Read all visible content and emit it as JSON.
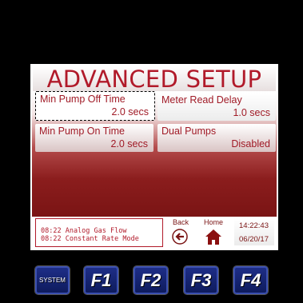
{
  "title": "ADVANCED SETUP",
  "fields": [
    {
      "label": "Min Pump Off Time",
      "value": "2.0 secs"
    },
    {
      "label": "Meter Read Delay",
      "value": "1.0 secs"
    },
    {
      "label": "Min Pump On Time",
      "value": "2.0 secs"
    },
    {
      "label": "Dual Pumps",
      "value": "Disabled"
    }
  ],
  "log": [
    "08:22 Analog Gas Flow",
    "08:22 Constant Rate Mode"
  ],
  "nav": {
    "back_label": "Back",
    "home_label": "Home"
  },
  "clock": {
    "time": "14:22:43",
    "date": "06/20/17"
  },
  "function_keys": [
    "SYSTEM",
    "F1",
    "F2",
    "F3",
    "F4"
  ],
  "icons": {
    "back": "back-arrow-icon",
    "home": "home-icon"
  },
  "colors": {
    "accent": "#b11a2a",
    "panel_dark": "#7a1414",
    "keys": "#1f2f8a"
  }
}
